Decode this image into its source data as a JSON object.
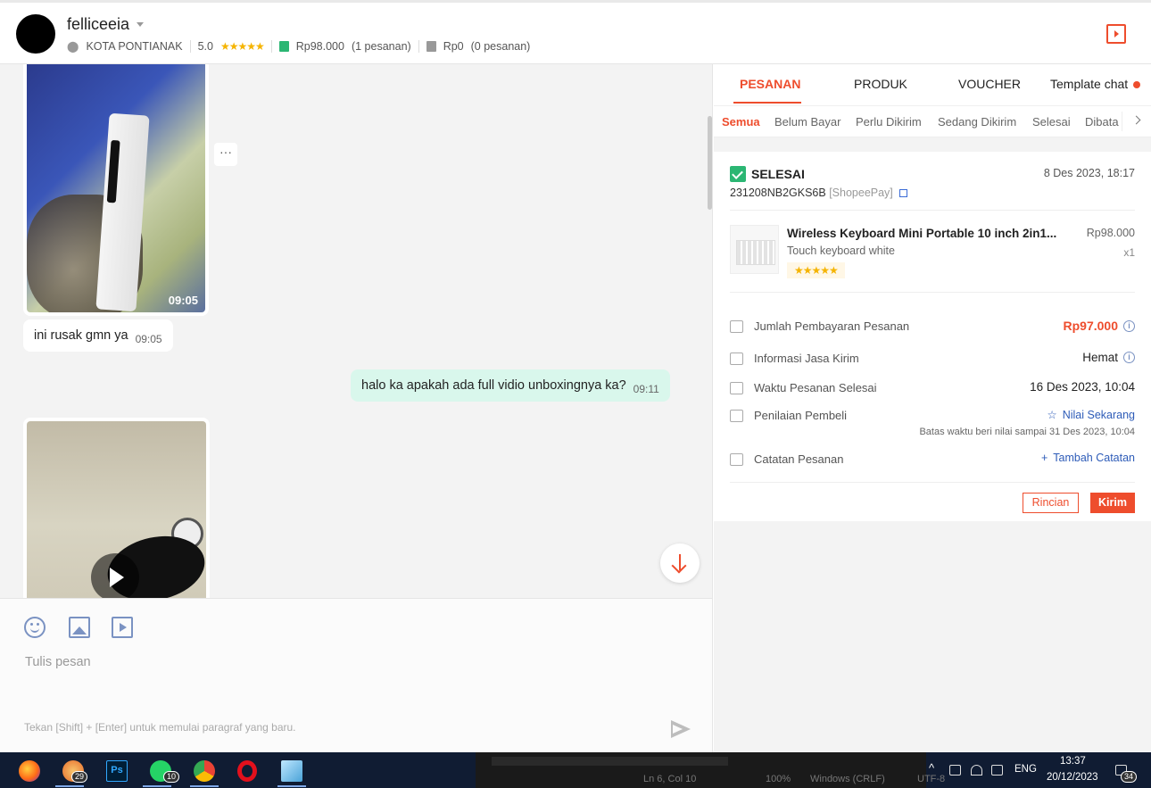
{
  "header": {
    "username": "felliceeia",
    "location": "KOTA PONTIANAK",
    "rating": "5.0",
    "rating_stars": "★★★★★",
    "paid_amount": "Rp98.000",
    "paid_orders": "(1 pesanan)",
    "unpaid_amount": "Rp0",
    "unpaid_orders": "(0 pesanan)"
  },
  "chat": {
    "messages": [
      {
        "type": "video",
        "time": "09:05"
      },
      {
        "type": "text",
        "direction": "in",
        "text": "ini rusak gmn ya",
        "time": "09:05"
      },
      {
        "type": "text",
        "direction": "out",
        "text": "halo ka apakah ada full vidio unboxingnya ka?",
        "time": "09:11"
      },
      {
        "type": "video"
      }
    ],
    "more_label": "···"
  },
  "composer": {
    "placeholder": "Tulis pesan",
    "hint": "Tekan [Shift] + [Enter] untuk memulai paragraf yang baru."
  },
  "panel": {
    "tabs": [
      "PESANAN",
      "PRODUK",
      "VOUCHER",
      "Template chat"
    ],
    "subtabs": [
      "Semua",
      "Belum Bayar",
      "Perlu Dikirim",
      "Sedang Dikirim",
      "Selesai",
      "Dibata"
    ],
    "order": {
      "status": "SELESAI",
      "date": "8 Des 2023, 18:17",
      "id": "231208NB2GKS6B",
      "payment": "[ShopeePay]",
      "product_name": "Wireless Keyboard Mini Portable 10 inch 2in1...",
      "variation": "Touch keyboard white",
      "product_stars": "★★★★★",
      "price": "Rp98.000",
      "qty": "x1",
      "rows": [
        {
          "label": "Jumlah Pembayaran Pesanan",
          "value": "Rp97.000"
        },
        {
          "label": "Informasi Jasa Kirim",
          "value": "Hemat"
        },
        {
          "label": "Waktu Pesanan Selesai",
          "value": "16 Des 2023, 10:04"
        },
        {
          "label": "Penilaian Pembeli",
          "value": "Nilai Sekarang"
        },
        {
          "label": "Catatan Pesanan",
          "value": "Tambah Catatan"
        }
      ],
      "rating_deadline": "Batas waktu beri nilai sampai 31 Des 2023, 10:04",
      "btn_detail": "Rincian",
      "btn_send": "Kirim"
    }
  },
  "taskbar": {
    "badges": {
      "app2": "29",
      "whatsapp": "10",
      "notifications": "34"
    },
    "editor_status": [
      "Ln 6, Col 10",
      "100%",
      "Windows (CRLF)",
      "UTF-8"
    ],
    "lang": "ENG",
    "time": "13:37",
    "date": "20/12/2023"
  },
  "colors": {
    "accent": "#ee4d2d",
    "bubble_out": "#d9f7ec",
    "link": "#2e5cb8"
  }
}
